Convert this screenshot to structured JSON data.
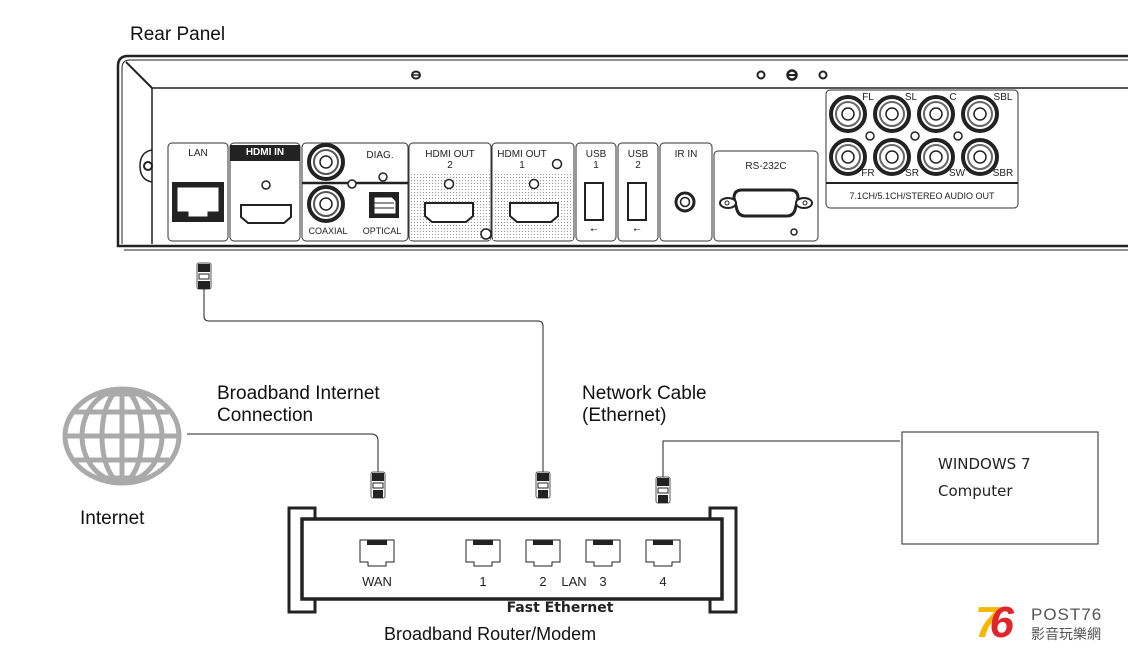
{
  "title": "Rear Panel",
  "rear_panel": {
    "lan_label": "LAN",
    "hdmi_in_label": "HDMI IN",
    "diag_label": "DIAG.",
    "coaxial_label": "COAXIAL",
    "optical_label": "OPTICAL",
    "hdmi_out2_label": "HDMI OUT",
    "hdmi_out2_num": "2",
    "hdmi_out1_label": "HDMI OUT",
    "hdmi_out1_num": "1",
    "usb1_label": "USB",
    "usb1_num": "1",
    "usb2_label": "USB",
    "usb2_num": "2",
    "ir_in_label": "IR IN",
    "rs232_label": "RS-232C",
    "audio_channels_top": [
      "FL",
      "SL",
      "C",
      "SBL"
    ],
    "audio_channels_bottom": [
      "FR",
      "SR",
      "SW",
      "SBR"
    ],
    "audio_out_label": "7.1CH/5.1CH/STEREO AUDIO OUT"
  },
  "labels": {
    "broadband_line1": "Broadband Internet",
    "broadband_line2": "Connection",
    "network_line1": "Network Cable",
    "network_line2": "(Ethernet)",
    "internet": "Internet"
  },
  "router": {
    "ports": [
      "WAN",
      "1",
      "2",
      "3",
      "4"
    ],
    "lan_label": "LAN",
    "fast_ethernet": "Fast Ethernet",
    "name": "Broadband Router/Modem"
  },
  "computer": {
    "line1": "WINDOWS 7",
    "line2": "Computer"
  },
  "logo": {
    "number": "76",
    "brand": "POST76",
    "chinese": "影音玩樂網",
    "color_yellow": "#f5b800",
    "color_red": "#e0262b"
  }
}
